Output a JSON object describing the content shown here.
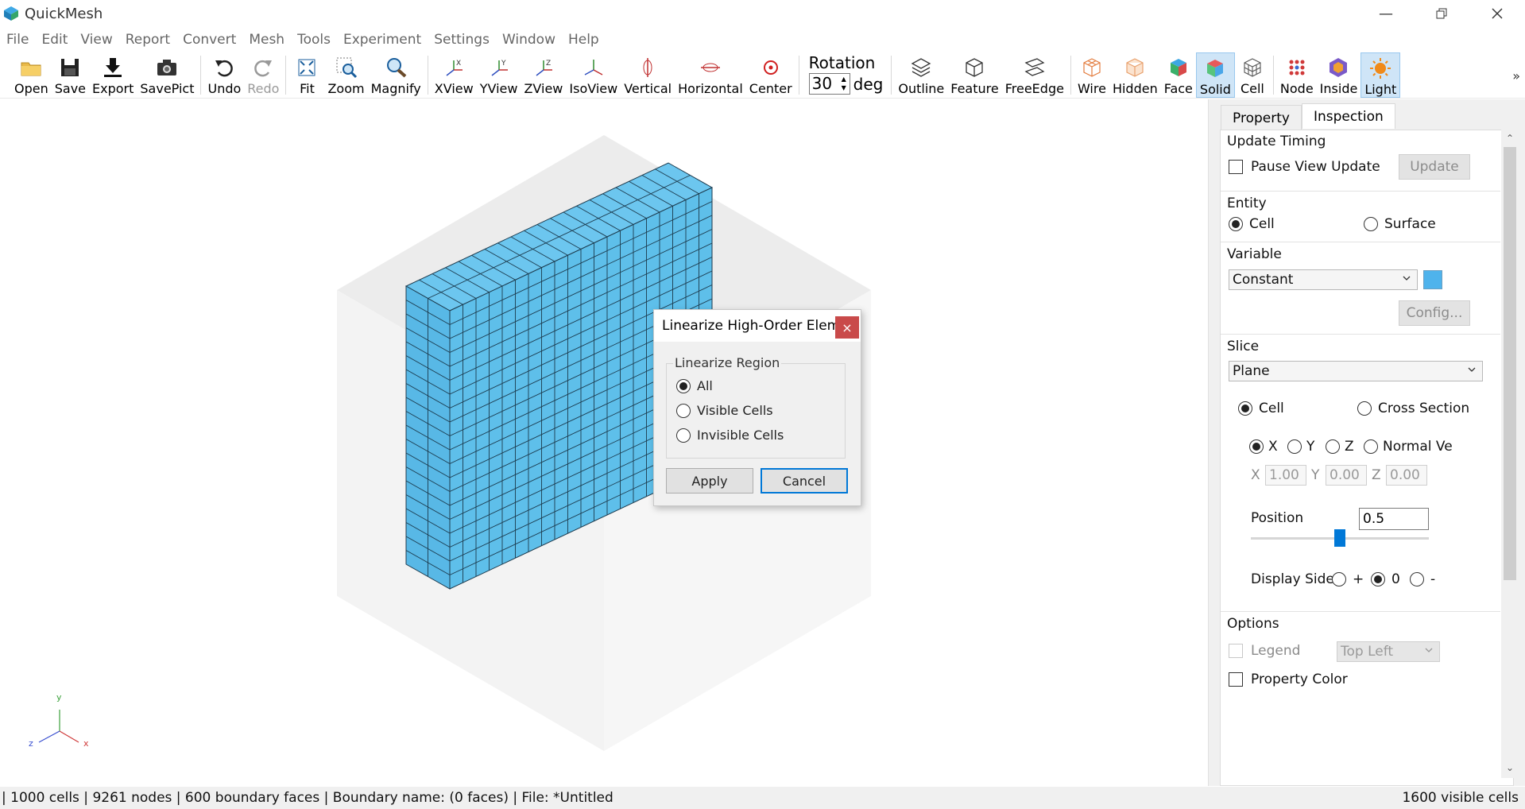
{
  "app": {
    "title": "QuickMesh",
    "colors": {
      "accent": "#0078d7",
      "mesh": "#5bbde9",
      "close": "#c94a4a"
    }
  },
  "menu": [
    "File",
    "Edit",
    "View",
    "Report",
    "Convert",
    "Mesh",
    "Tools",
    "Experiment",
    "Settings",
    "Window",
    "Help"
  ],
  "toolbar": {
    "open": "Open",
    "save": "Save",
    "export": "Export",
    "savepict": "SavePict",
    "undo": "Undo",
    "redo": "Redo",
    "fit": "Fit",
    "zoom": "Zoom",
    "magnify": "Magnify",
    "xview": "XView",
    "yview": "YView",
    "zview": "ZView",
    "isoview": "IsoView",
    "vertical": "Vertical",
    "horizontal": "Horizontal",
    "center": "Center",
    "rotation_label": "Rotation",
    "rotation_value": "30",
    "rotation_unit": "deg",
    "outline": "Outline",
    "feature": "Feature",
    "freeedge": "FreeEdge",
    "wire": "Wire",
    "hidden": "Hidden",
    "face": "Face",
    "solid": "Solid",
    "cell": "Cell",
    "node": "Node",
    "inside": "Inside",
    "light": "Light",
    "more": "»"
  },
  "dialog": {
    "title": "Linearize High-Order Elem...",
    "close": "×",
    "group_label": "Linearize Region",
    "options": [
      "All",
      "Visible Cells",
      "Invisible Cells"
    ],
    "selected": "All",
    "apply": "Apply",
    "cancel": "Cancel"
  },
  "panel": {
    "tabs": [
      "Property",
      "Inspection"
    ],
    "active_tab": "Inspection",
    "update_timing": {
      "title": "Update Timing",
      "pause_label": "Pause View Update",
      "update_button": "Update"
    },
    "entity": {
      "title": "Entity",
      "cell": "Cell",
      "surface": "Surface",
      "selected": "Cell"
    },
    "variable": {
      "title": "Variable",
      "value": "Constant",
      "config_button": "Config...",
      "color": "#4fb3ec"
    },
    "slice": {
      "title": "Slice",
      "type": "Plane",
      "cell": "Cell",
      "cross_section": "Cross Section",
      "axes": {
        "x": "X",
        "y": "Y",
        "z": "Z",
        "normal": "Normal Ve"
      },
      "selected_axis": "X",
      "x_label": "X",
      "x_value": "1.00",
      "y_label": "Y",
      "y_value": "0.00",
      "z_label": "Z",
      "z_value": "0.00",
      "position_label": "Position",
      "position_value": "0.5",
      "display_side_label": "Display Side",
      "side_plus": "+",
      "side_zero": "0",
      "side_minus": "-",
      "slider_fraction": 0.5
    },
    "options": {
      "title": "Options",
      "legend_label": "Legend",
      "legend_position": "Top Left",
      "property_color_label": "Property Color"
    }
  },
  "status": {
    "left": "| 1000 cells | 9261 nodes | 600 boundary faces |  Boundary name:  (0 faces) | File: *Untitled",
    "right": "1600 visible cells"
  },
  "axes_triad": {
    "x": "x",
    "y": "y",
    "z": "z"
  }
}
